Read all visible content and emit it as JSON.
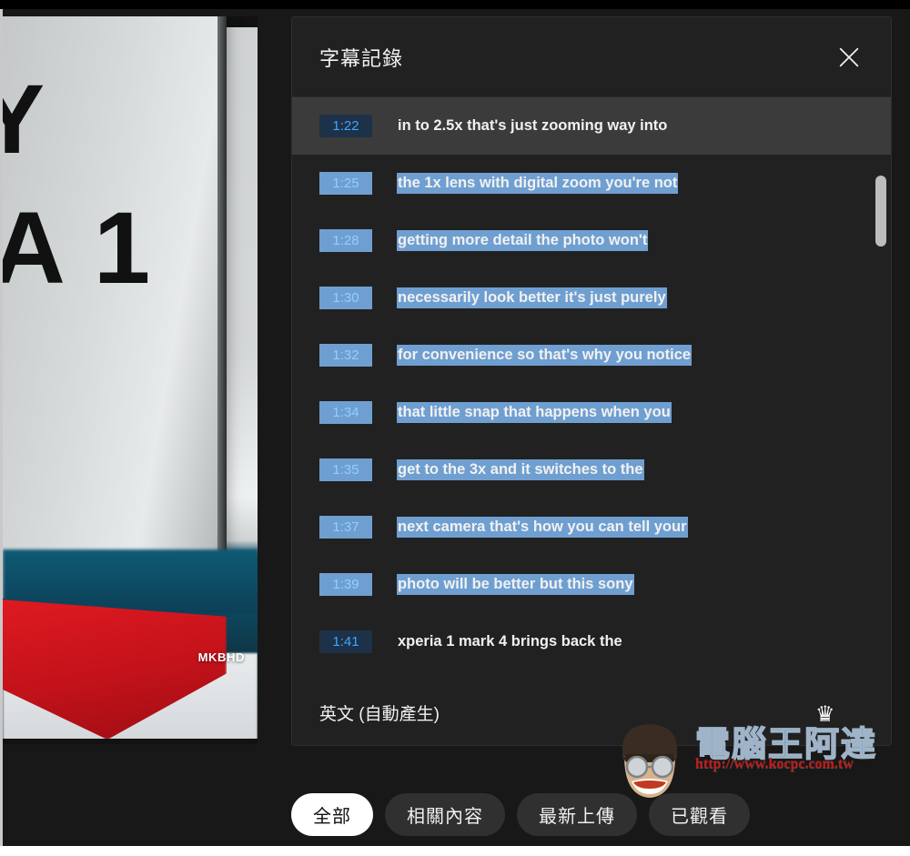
{
  "panel": {
    "title": "字幕記錄",
    "close_icon": "close-icon",
    "language_label": "英文 (自動產生)",
    "scrollbar": {
      "name": "transcript-scrollbar"
    }
  },
  "transcript": {
    "rows": [
      {
        "time": "1:22",
        "text": "in to 2.5x that's just zooming way into",
        "active": true,
        "selected": false
      },
      {
        "time": "1:25",
        "text": "the 1x lens with digital zoom you're not",
        "active": false,
        "selected": true
      },
      {
        "time": "1:28",
        "text": "getting more detail the photo won't",
        "active": false,
        "selected": true
      },
      {
        "time": "1:30",
        "text": "necessarily look better it's just purely",
        "active": false,
        "selected": true
      },
      {
        "time": "1:32",
        "text": "for convenience so that's why you notice",
        "active": false,
        "selected": true
      },
      {
        "time": "1:34",
        "text": "that little snap that happens when you",
        "active": false,
        "selected": true
      },
      {
        "time": "1:35",
        "text": "get to the 3x and it switches to the",
        "active": false,
        "selected": true
      },
      {
        "time": "1:37",
        "text": "next camera that's how you can tell your",
        "active": false,
        "selected": true
      },
      {
        "time": "1:39",
        "text": "photo will be better but this sony",
        "active": false,
        "selected": true
      },
      {
        "time": "1:41",
        "text": "xperia 1 mark 4 brings back the",
        "active": false,
        "selected": false
      }
    ]
  },
  "filter_chips": [
    {
      "label": "全部",
      "active": true
    },
    {
      "label": "相關內容",
      "active": false
    },
    {
      "label": "最新上傳",
      "active": false
    },
    {
      "label": "已觀看",
      "active": false
    }
  ],
  "video": {
    "overlay_text_1": "Y",
    "overlay_text_2": "A 1",
    "channel_watermark": "MKBHD"
  },
  "site_watermark": {
    "name": "電腦王阿達",
    "url": "http://www.kocpc.com.tw",
    "crown_icon": "crown-icon"
  },
  "colors": {
    "panel_bg": "#212121",
    "active_row_bg": "#3b3b3b",
    "timestamp_blue": "#3ea6ff",
    "timestamp_chip_bg": "#1d3148",
    "selection_blue": "#6f9fd1",
    "chip_bg": "#303030",
    "chip_active_bg": "#ffffff",
    "text_primary": "#f1f1f1",
    "scrollbar_thumb": "#bdbdbd"
  }
}
